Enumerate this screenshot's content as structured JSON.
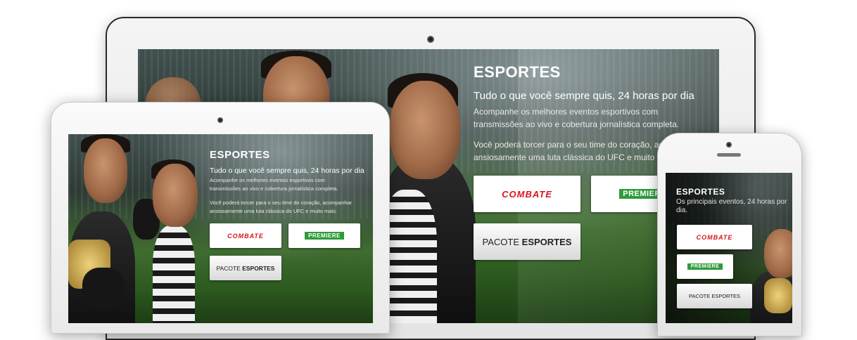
{
  "desktop": {
    "title": "ESPORTES",
    "subtitle": "Tudo o que você sempre quis, 24 horas por dia",
    "description_line1": "Acompanhe os melhores eventos esportivos com",
    "description_line2": "transmissões ao vivo e cobertura jornalística completa.",
    "extra_line1": "Você poderá torcer para o seu time do coração, ac",
    "extra_line2": "ansiosamente uma luta clássica do UFC e muito m",
    "combate_label": "COMBATE",
    "premiere_label": "PREMIERE",
    "pacote_prefix": "PACOTE ",
    "pacote_bold": "ESPORTES"
  },
  "tablet": {
    "title": "ESPORTES",
    "subtitle": "Tudo o que você sempre quis, 24 horas por dia",
    "description_line1": "Acompanhe os melhores eventos esportivos com",
    "description_line2": "transmissões ao vivo e cobertura jornalística completa.",
    "extra_line1": "Você poderá torcer para o seu time do coração, acompanhar",
    "extra_line2": "ansiosamente uma luta clássica do UFC e muito mais.",
    "combate_label": "COMBATE",
    "premiere_label": "PREMIERE",
    "pacote_prefix": "PACOTE ",
    "pacote_bold": "ESPORTES"
  },
  "phone": {
    "title": "ESPORTES",
    "subtitle_line1": "Os principais eventos, 24 horas por",
    "subtitle_line2": "dia.",
    "combate_label": "COMBATE",
    "premiere_label": "PREMIERE",
    "pacote_label": "PACOTE ESPORTES"
  },
  "colors": {
    "combate_red": "#d4161d",
    "premiere_green": "#2e9c3a",
    "field_green": "#3f6d30"
  }
}
